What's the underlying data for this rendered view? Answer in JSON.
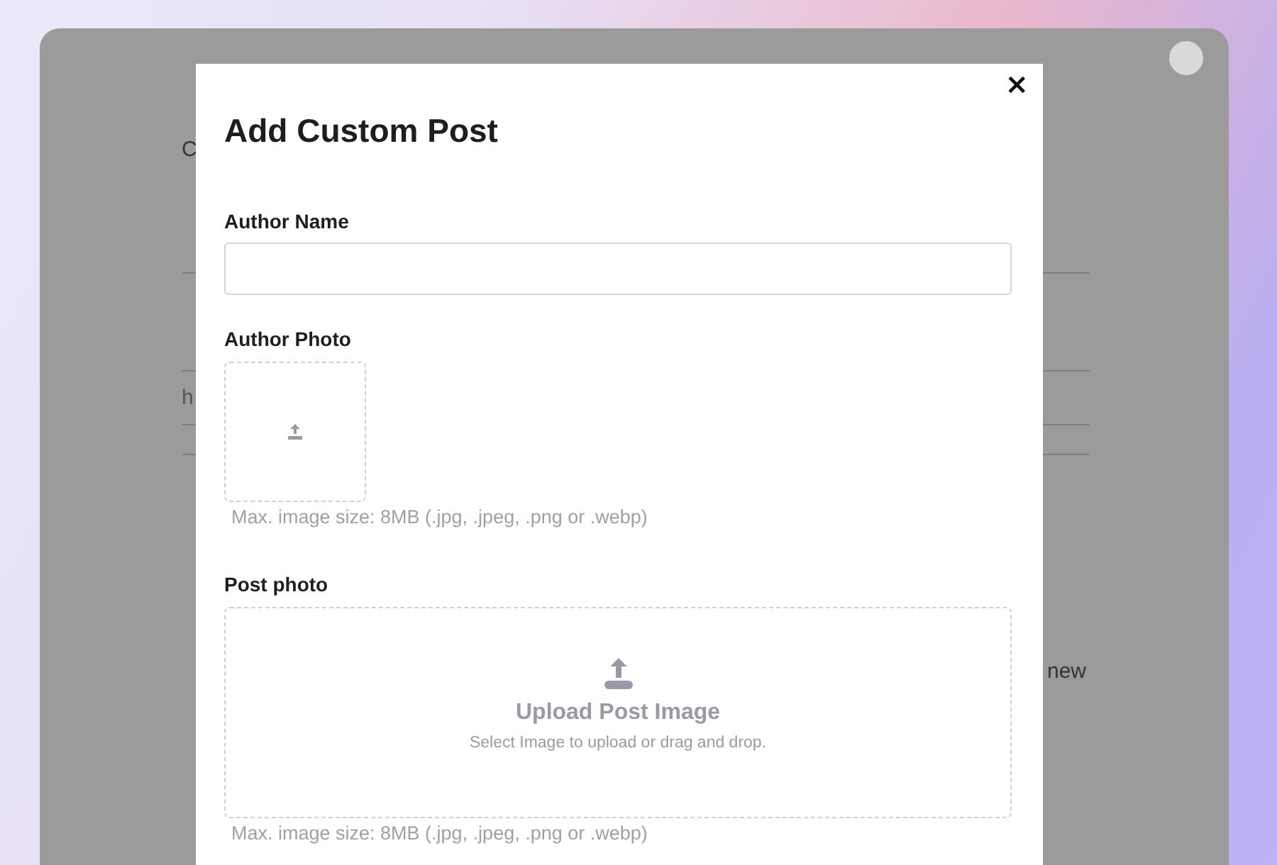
{
  "background_page": {
    "heading_fragment": "C",
    "row_fragment": "h",
    "text_fragment": "new"
  },
  "modal": {
    "title": "Add Custom Post",
    "close": "×",
    "fields": [
      {
        "kind": "text",
        "label": "Author Name"
      },
      {
        "kind": "image_small",
        "label": "Author Photo",
        "hint": "Max. image size: 8MB (.jpg, .jpeg, .png or .webp)"
      },
      {
        "kind": "image_large",
        "label": "Post photo",
        "upload_title": "Upload Post Image",
        "upload_subtitle": "Select Image to upload or drag and drop.",
        "hint": "Max. image size: 8MB (.jpg, .jpeg, .png or .webp)"
      }
    ]
  }
}
